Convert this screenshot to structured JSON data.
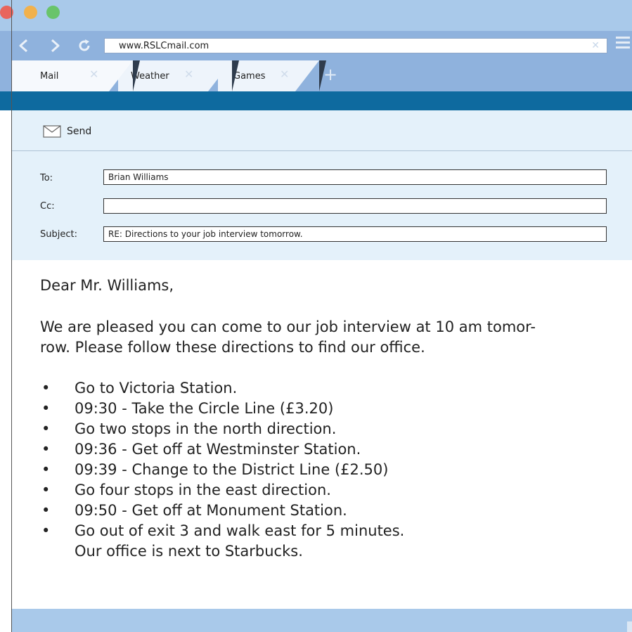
{
  "browser": {
    "url": "www.RSLCmail.com",
    "tabs": [
      {
        "label": "Mail"
      },
      {
        "label": "Weather"
      },
      {
        "label": "Games"
      }
    ],
    "close_glyph": "✕",
    "add_glyph": "+",
    "icons": [
      "back-arrow-icon",
      "forward-arrow-icon",
      "refresh-icon",
      "menu-icon",
      "mail-envelope-icon"
    ]
  },
  "compose": {
    "send_label": "Send",
    "to_label": "To:",
    "to_value": "Brian Williams",
    "cc_label": "Cc:",
    "cc_value": "",
    "subject_label": "Subject:",
    "subject_value": "RE: Directions to your job interview tomorrow."
  },
  "message": {
    "greeting": "Dear Mr. Williams,",
    "intro_line1": "We are pleased you can come to our job interview at 10 am tomor-",
    "intro_line2": "row. Please follow these directions to find our office.",
    "bullet": "•",
    "steps": [
      "Go to Victoria Station.",
      "09:30 - Take the Circle Line (£3.20)",
      "Go two stops in the north direction.",
      "09:36 - Get off at Westminster Station.",
      "09:39 - Change to the District Line (£2.50)",
      "Go four stops in the east direction.",
      "09:50 - Get off at Monument Station.",
      "Go out of exit 3 and walk east for 5 minutes."
    ],
    "closing": "Our office is next to Starbucks."
  },
  "colors": {
    "titlebar": "#a9c9ea",
    "toolbar": "#8fb2dd",
    "accent_bar": "#0e6a9f",
    "compose_bg": "#e4f1fa"
  }
}
